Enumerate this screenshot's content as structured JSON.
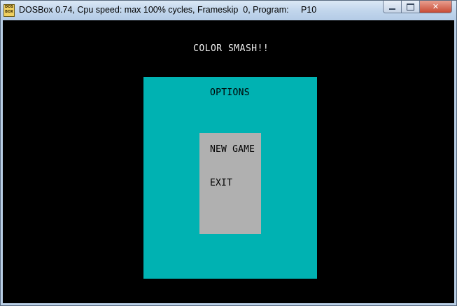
{
  "window": {
    "title": "DOSBox 0.74, Cpu speed: max 100% cycles, Frameskip  0, Program:     P10",
    "app_icon_text": "DOS BOX",
    "app_icon_name": "dosbox-icon",
    "buttons": {
      "minimize_icon": "minimize-icon",
      "maximize_icon": "maximize-icon",
      "close_symbol": "✕"
    }
  },
  "game": {
    "title": "COLOR SMASH!!",
    "options_label": "OPTIONS",
    "menu": [
      {
        "label": "NEW GAME"
      },
      {
        "label": "EXIT"
      }
    ],
    "colors": {
      "background": "#000000",
      "panel": "#00b2b2",
      "menu_box": "#b0b0b0",
      "title_text": "#f0f0f0"
    }
  }
}
